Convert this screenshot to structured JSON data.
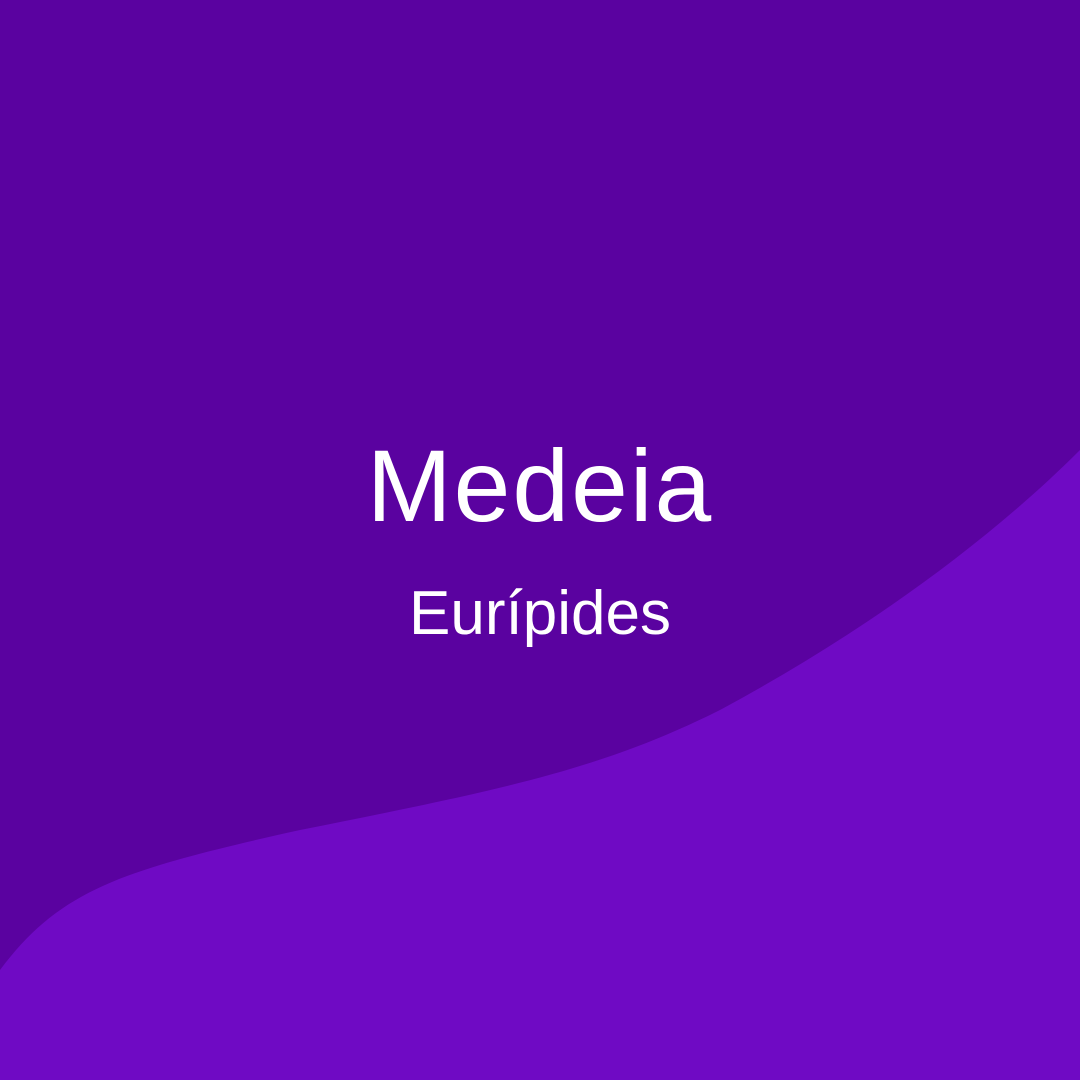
{
  "title": "Medeia",
  "author": "Eurípides",
  "colors": {
    "background": "#5a02a0",
    "wave": "#6f0ac4",
    "text": "#ffffff"
  }
}
